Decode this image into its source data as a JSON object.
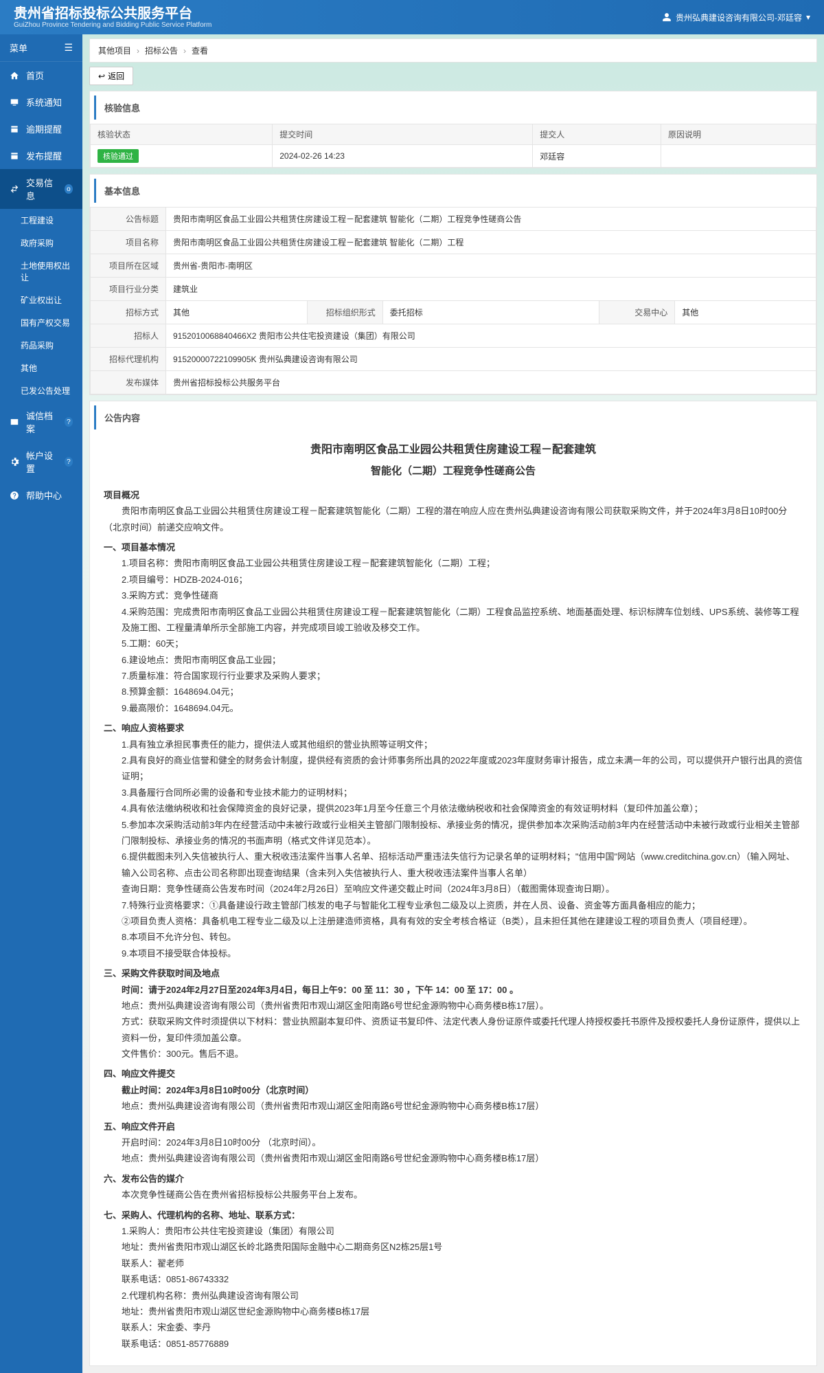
{
  "header": {
    "title": "贵州省招标投标公共服务平台",
    "subtitle": "GuiZhou Province Tendering and Bidding Public Service Platform",
    "user": "贵州弘典建设咨询有限公司-邓廷容"
  },
  "sidebar": {
    "menu_label": "菜单",
    "items": [
      {
        "label": "首页"
      },
      {
        "label": "系统通知"
      },
      {
        "label": "逾期提醒"
      },
      {
        "label": "发布提醒"
      },
      {
        "label": "交易信息",
        "active": true,
        "badge": "o"
      },
      {
        "label": "诚信档案",
        "badge": "?"
      },
      {
        "label": "帐户设置",
        "badge": "?"
      },
      {
        "label": "帮助中心"
      }
    ],
    "sub": [
      "工程建设",
      "政府采购",
      "土地使用权出让",
      "矿业权出让",
      "国有产权交易",
      "药品采购",
      "其他",
      "已发公告处理"
    ]
  },
  "crumb": {
    "a": "其他项目",
    "b": "招标公告",
    "c": "查看"
  },
  "back_label": "返回",
  "verify": {
    "title": "核验信息",
    "headers": [
      "核验状态",
      "提交时间",
      "提交人",
      "原因说明"
    ],
    "status": "核验通过",
    "time": "2024-02-26 14:23",
    "person": "邓廷容",
    "reason": ""
  },
  "basic": {
    "title": "基本信息",
    "rows": {
      "notice_title_l": "公告标题",
      "notice_title_v": "贵阳市南明区食品工业园公共租赁住房建设工程－配套建筑 智能化（二期）工程竞争性磋商公告",
      "proj_name_l": "项目名称",
      "proj_name_v": "贵阳市南明区食品工业园公共租赁住房建设工程－配套建筑 智能化（二期）工程",
      "region_l": "项目所在区域",
      "region_v": "贵州省-贵阳市-南明区",
      "industry_l": "项目行业分类",
      "industry_v": "建筑业",
      "method_l": "招标方式",
      "method_v": "其他",
      "orgform_l": "招标组织形式",
      "orgform_v": "委托招标",
      "center_l": "交易中心",
      "center_v": "其他",
      "tenderer_l": "招标人",
      "tenderer_v": "9152010068840466X2 贵阳市公共住宅投资建设（集团）有限公司",
      "agency_l": "招标代理机构",
      "agency_v": "91520000722109905K 贵州弘典建设咨询有限公司",
      "media_l": "发布媒体",
      "media_v": "贵州省招标投标公共服务平台"
    }
  },
  "content": {
    "section_title": "公告内容",
    "doc_title1": "贵阳市南明区食品工业园公共租赁住房建设工程－配套建筑",
    "doc_title2": "智能化（二期）工程竞争性磋商公告",
    "overview_h": "项目概况",
    "overview_p": "贵阳市南明区食品工业园公共租赁住房建设工程－配套建筑智能化（二期）工程的潜在响应人应在贵州弘典建设咨询有限公司获取采购文件，并于2024年3月8日10时00分（北京时间）前递交应响文件。",
    "s1_h": "一、项目基本情况",
    "s1": [
      "1.项目名称：贵阳市南明区食品工业园公共租赁住房建设工程－配套建筑智能化（二期）工程；",
      "2.项目编号：HDZB-2024-016；",
      "3.采购方式：竞争性磋商",
      "4.采购范围：完成贵阳市南明区食品工业园公共租赁住房建设工程－配套建筑智能化（二期）工程食品监控系统、地面基面处理、标识标牌车位划线、UPS系统、装修等工程及施工图、工程量清单所示全部施工内容，并完成项目竣工验收及移交工作。",
      "5.工期：60天；",
      "6.建设地点：贵阳市南明区食品工业园；",
      "7.质量标准：符合国家现行行业要求及采购人要求；",
      "8.预算金额：1648694.04元；",
      "9.最高限价：1648694.04元。"
    ],
    "s2_h": "二、响应人资格要求",
    "s2": [
      "1.具有独立承担民事责任的能力，提供法人或其他组织的营业执照等证明文件；",
      "2.具有良好的商业信誉和健全的财务会计制度，提供经有资质的会计师事务所出具的2022年度或2023年度财务审计报告，成立未满一年的公司，可以提供开户银行出具的资信证明；",
      "3.具备履行合同所必需的设备和专业技术能力的证明材料；",
      "4.具有依法缴纳税收和社会保障资金的良好记录，提供2023年1月至今任意三个月依法缴纳税收和社会保障资金的有效证明材料（复印件加盖公章）；",
      "5.参加本次采购活动前3年内在经营活动中未被行政或行业相关主管部门限制投标、承接业务的情况，提供参加本次采购活动前3年内在经营活动中未被行政或行业相关主管部门限制投标、承接业务的情况的书面声明（格式文件详见范本）。",
      "6.提供截图未列入失信被执行人、重大税收违法案件当事人名单、招标活动严重违法失信行为记录名单的证明材料；\"信用中国\"网站（www.creditchina.gov.cn）（输入网址、输入公司名称、点击公司名称即出现查询结果（含未列入失信被执行人、重大税收违法案件当事人名单）",
      "查询日期：竞争性磋商公告发布时间（2024年2月26日）至响应文件递交截止时间（2024年3月8日）（截图需体现查询日期）。",
      "7.特殊行业资格要求：①具备建设行政主管部门核发的电子与智能化工程专业承包二级及以上资质，并在人员、设备、资金等方面具备相应的能力；",
      "②项目负责人资格：具备机电工程专业二级及以上注册建造师资格，具有有效的安全考核合格证（B类），且未担任其他在建建设工程的项目负责人（项目经理）。",
      "8.本项目不允许分包、转包。",
      "9.本项目不接受联合体投标。"
    ],
    "s3_h": "三、采购文件获取时间及地点",
    "s3_time": "时间：请于2024年2月27日至2024年3月4日，每日上午9：00 至 11：30 ，下午 14：00 至 17：00 。",
    "s3": [
      "地点：贵州弘典建设咨询有限公司（贵州省贵阳市观山湖区金阳南路6号世纪金源购物中心商务楼B栋17层）。",
      "方式：获取采购文件时须提供以下材料：营业执照副本复印件、资质证书复印件、法定代表人身份证原件或委托代理人持授权委托书原件及授权委托人身份证原件，提供以上资料一份，复印件须加盖公章。",
      "文件售价：300元。售后不退。"
    ],
    "s4_h": "四、响应文件提交",
    "s4_deadline": "截止时间：2024年3月8日10时00分（北京时间）",
    "s4_addr": "地点：贵州弘典建设咨询有限公司（贵州省贵阳市观山湖区金阳南路6号世纪金源购物中心商务楼B栋17层）",
    "s5_h": "五、响应文件开启",
    "s5": [
      "开启时间：2024年3月8日10时00分 （北京时间）。",
      "地点：贵州弘典建设咨询有限公司（贵州省贵阳市观山湖区金阳南路6号世纪金源购物中心商务楼B栋17层）"
    ],
    "s6_h": "六、发布公告的媒介",
    "s6": "本次竞争性磋商公告在贵州省招标投标公共服务平台上发布。",
    "s7_h": "七、采购人、代理机构的名称、地址、联系方式：",
    "s7": [
      "1.采购人：贵阳市公共住宅投资建设（集团）有限公司",
      "地址：贵州省贵阳市观山湖区长岭北路贵阳国际金融中心二期商务区N2栋25层1号",
      "联系人：翟老师",
      "联系电话：0851-86743332",
      "2.代理机构名称：贵州弘典建设咨询有限公司",
      "地址：贵州省贵阳市观山湖区世纪金源购物中心商务楼B栋17层",
      "联系人：宋金委、李丹",
      "联系电话：0851-85776889"
    ]
  }
}
